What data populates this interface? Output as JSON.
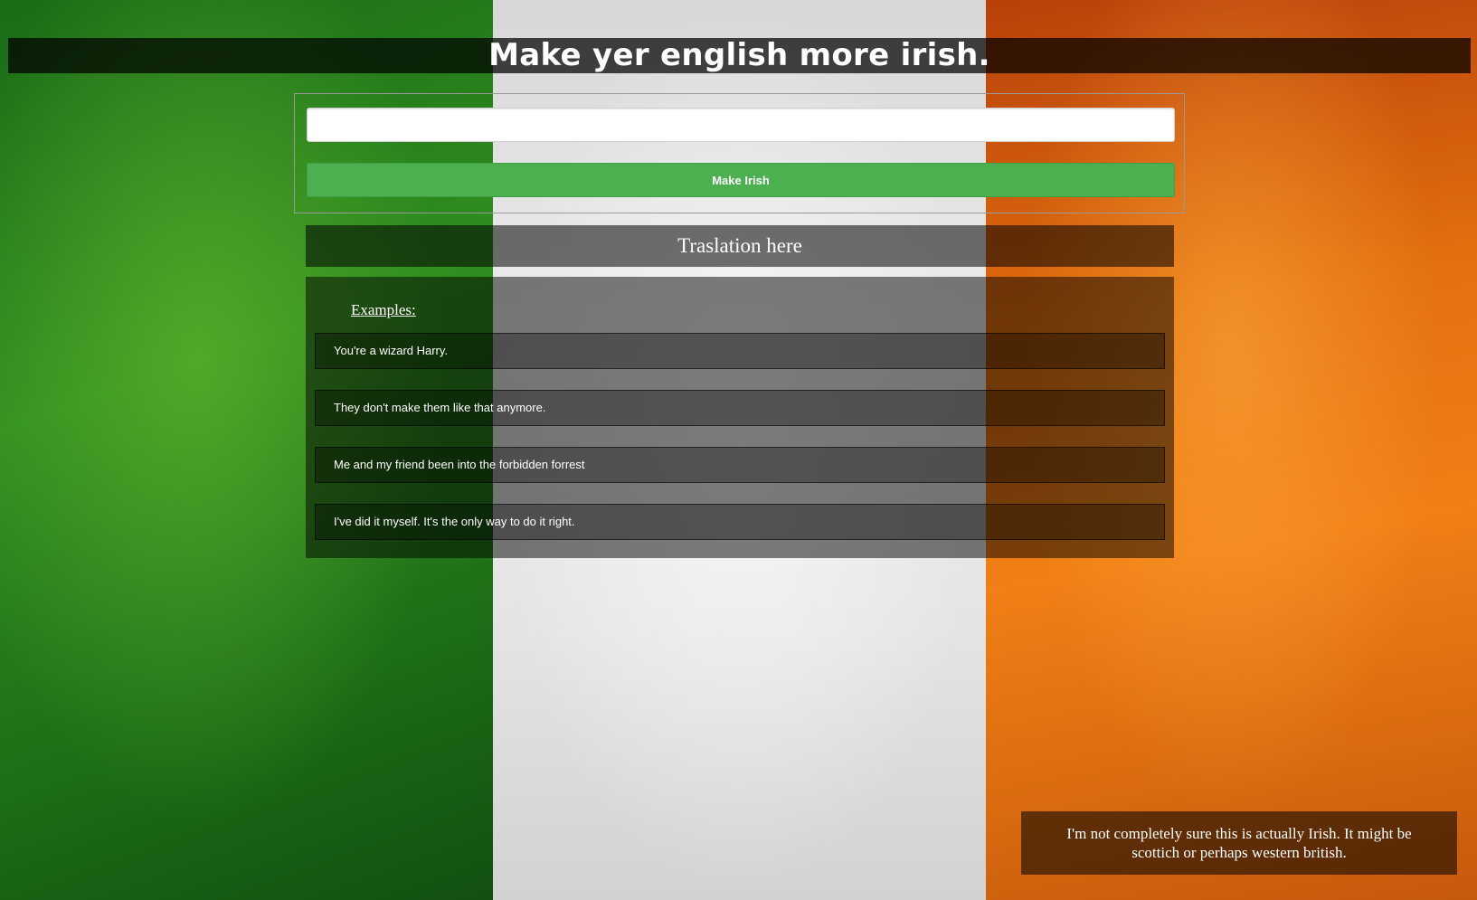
{
  "background": {
    "icon": "irish-flag-background",
    "colors": {
      "green": "#2f8f1f",
      "white": "#e6e6e6",
      "orange": "#f07f15"
    }
  },
  "header": {
    "title": "Make yer english more irish."
  },
  "form": {
    "input_value": "",
    "input_placeholder": "",
    "button_label": "Make Irish",
    "button_color": "#4caf50"
  },
  "translation": {
    "text": "Traslation here"
  },
  "examples": {
    "heading": "Examples:",
    "items": [
      "You're a wizard Harry.",
      "They don't make them like that anymore.",
      "Me and my friend been into the forbidden forrest",
      "I've did it myself. It's the only way to do it right."
    ]
  },
  "footer": {
    "note": "I'm not completely sure this is actually Irish. It might be scottich or perhaps western british."
  }
}
